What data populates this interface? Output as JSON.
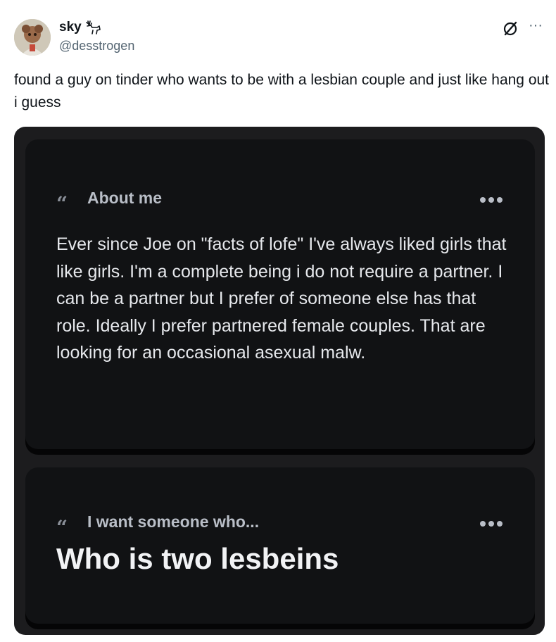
{
  "author": {
    "display_name": "sky",
    "handle": "@desstrogen"
  },
  "tweet": {
    "text": "found a guy on tinder who wants to be with a lesbian couple and just like hang out i guess"
  },
  "header_icons": {
    "grok": "grok-icon",
    "more": "more-icon",
    "more_glyph": "···"
  },
  "media": {
    "about_card": {
      "heading": "About me",
      "body": "Ever since Joe on \"facts of lofe\" I've always liked girls that like girls. I'm a complete being i do not require a partner.  I can be a partner but I prefer of someone else has that role. Ideally I prefer partnered female couples. That are looking for an occasional asexual malw."
    },
    "want_card": {
      "heading": "I want someone who...",
      "body": "Who is two lesbeins"
    },
    "quote_glyph": "“"
  },
  "colors": {
    "text_primary": "#0f1419",
    "text_secondary": "#536471",
    "media_bg": "#1c1c1e",
    "card_bg": "#111214"
  }
}
